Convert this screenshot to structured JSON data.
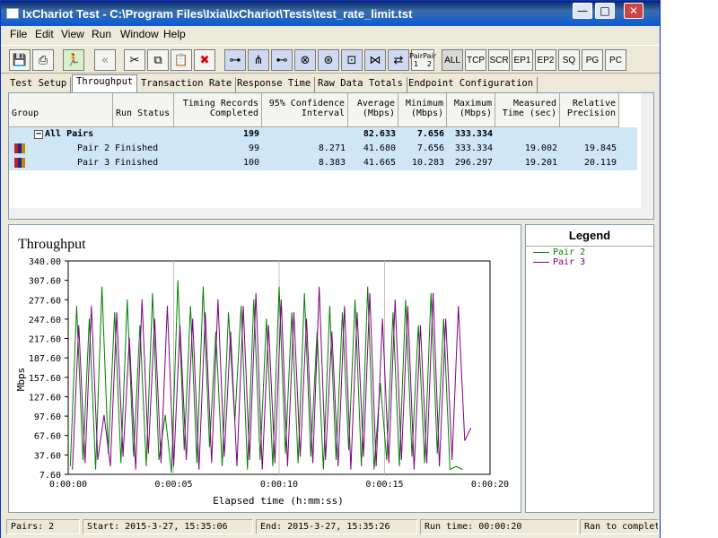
{
  "window": {
    "title": "IxChariot Test - C:\\Program Files\\Ixia\\IxChariot\\Tests\\test_rate_limit.tst"
  },
  "title_buttons": {
    "minimize": "—",
    "maximize": "□",
    "close": "✕"
  },
  "menu": [
    "File",
    "Edit",
    "View",
    "Run",
    "Window",
    "Help"
  ],
  "toolbar": {
    "icons": [
      "save-icon",
      "print-icon",
      "run-icon",
      "back-arrows-icon",
      "cut-icon",
      "copy-icon",
      "paste-icon",
      "delete-icon",
      "pair-icon",
      "multicast-icon",
      "mpair-icon",
      "group-icon",
      "group2-icon",
      "pair-edit-icon",
      "pair-group-icon",
      "pair-swap-icon"
    ],
    "pair_label_1": "Pair 1",
    "pair_label_2": "Pair 2",
    "filters": [
      "ALL",
      "TCP",
      "SCR",
      "EP1",
      "EP2",
      "SQ",
      "PG",
      "PC"
    ]
  },
  "tabs": [
    "Test Setup",
    "Throughput",
    "Transaction Rate",
    "Response Time",
    "Raw Data Totals",
    "Endpoint Configuration"
  ],
  "grid": {
    "headers": [
      {
        "l1": "",
        "l2": "Group"
      },
      {
        "l1": "",
        "l2": "Run Status"
      },
      {
        "l1": "Timing Records",
        "l2": "Completed"
      },
      {
        "l1": "95% Confidence",
        "l2": "Interval"
      },
      {
        "l1": "Average",
        "l2": "(Mbps)"
      },
      {
        "l1": "Minimum",
        "l2": "(Mbps)"
      },
      {
        "l1": "Maximum",
        "l2": "(Mbps)"
      },
      {
        "l1": "Measured",
        "l2": "Time (sec)"
      },
      {
        "l1": "Relative",
        "l2": "Precision"
      }
    ],
    "all_pairs": {
      "expander": "−",
      "name": "All Pairs",
      "records": "199",
      "average": "82.633",
      "minimum": "7.656",
      "maximum": "333.334"
    },
    "rows": [
      {
        "name": "Pair 2",
        "status": "Finished",
        "records": "99",
        "ci": "8.271",
        "average": "41.680",
        "minimum": "7.656",
        "maximum": "333.334",
        "time": "19.002",
        "precision": "19.845"
      },
      {
        "name": "Pair 3",
        "status": "Finished",
        "records": "100",
        "ci": "8.383",
        "average": "41.665",
        "minimum": "10.283",
        "maximum": "296.297",
        "time": "19.201",
        "precision": "20.119"
      }
    ]
  },
  "legend": {
    "title": "Legend",
    "items": [
      {
        "label": "Pair 2",
        "color": "#008000"
      },
      {
        "label": "Pair 3",
        "color": "#800080"
      }
    ]
  },
  "chart_data": {
    "type": "line",
    "title": "Throughput",
    "xlabel": "Elapsed time (h:mm:ss)",
    "ylabel": "Mbps",
    "ylim": [
      7.6,
      340.0
    ],
    "xlim": [
      0,
      20
    ],
    "yticks": [
      "340.00",
      "307.60",
      "277.60",
      "247.60",
      "217.60",
      "187.60",
      "157.60",
      "127.60",
      "97.60",
      "67.60",
      "37.60",
      "7.60"
    ],
    "xticks": [
      "0:00:00",
      "0:00:05",
      "0:00:10",
      "0:00:15",
      "0:00:20"
    ],
    "grid": true,
    "series": [
      {
        "name": "Pair 2",
        "color": "#008000",
        "x": [
          0.1,
          0.4,
          0.7,
          1.0,
          1.3,
          1.6,
          1.9,
          2.2,
          2.5,
          2.8,
          3.1,
          3.4,
          3.7,
          4.0,
          4.3,
          4.6,
          4.9,
          5.2,
          5.5,
          5.8,
          6.1,
          6.4,
          6.7,
          7.0,
          7.3,
          7.6,
          7.9,
          8.2,
          8.5,
          8.8,
          9.1,
          9.4,
          9.7,
          10.0,
          10.3,
          10.6,
          10.9,
          11.2,
          11.5,
          11.8,
          12.1,
          12.4,
          12.7,
          13.0,
          13.3,
          13.6,
          13.9,
          14.2,
          14.5,
          14.8,
          15.1,
          15.4,
          15.7,
          16.0,
          16.3,
          16.6,
          16.9,
          17.2,
          17.5,
          17.8,
          18.1,
          18.4,
          18.7
        ],
        "y": [
          20,
          270,
          30,
          250,
          15,
          300,
          40,
          260,
          25,
          280,
          35,
          240,
          20,
          290,
          30,
          100,
          10,
          310,
          45,
          270,
          25,
          300,
          50,
          230,
          20,
          260,
          90,
          270,
          15,
          280,
          30,
          250,
          20,
          300,
          40,
          260,
          25,
          290,
          35,
          230,
          15,
          270,
          30,
          260,
          45,
          280,
          20,
          300,
          15,
          150,
          30,
          260,
          20,
          280,
          35,
          240,
          25,
          290,
          40,
          250,
          15,
          20,
          15
        ]
      },
      {
        "name": "Pair 3",
        "color": "#800080",
        "x": [
          0.2,
          0.5,
          0.8,
          1.1,
          1.4,
          1.7,
          2.0,
          2.3,
          2.6,
          2.9,
          3.2,
          3.5,
          3.8,
          4.1,
          4.4,
          4.7,
          5.0,
          5.3,
          5.6,
          5.9,
          6.2,
          6.5,
          6.8,
          7.1,
          7.4,
          7.7,
          8.0,
          8.3,
          8.6,
          8.9,
          9.2,
          9.5,
          9.8,
          10.1,
          10.4,
          10.7,
          11.0,
          11.3,
          11.6,
          11.9,
          12.2,
          12.5,
          12.8,
          13.1,
          13.4,
          13.7,
          14.0,
          14.3,
          14.6,
          14.9,
          15.2,
          15.5,
          15.8,
          16.1,
          16.4,
          16.7,
          17.0,
          17.3,
          17.6,
          17.9,
          18.2,
          18.5,
          18.8,
          19.1
        ],
        "y": [
          15,
          240,
          25,
          270,
          30,
          100,
          20,
          260,
          35,
          220,
          15,
          280,
          40,
          250,
          25,
          270,
          20,
          240,
          30,
          250,
          15,
          260,
          25,
          280,
          35,
          230,
          20,
          270,
          30,
          290,
          15,
          240,
          25,
          280,
          20,
          260,
          35,
          250,
          25,
          300,
          30,
          230,
          20,
          270,
          15,
          260,
          35,
          290,
          20,
          250,
          25,
          280,
          30,
          270,
          15,
          240,
          25,
          290,
          20,
          250,
          30,
          270,
          60,
          80
        ]
      }
    ]
  },
  "status": {
    "pairs": "Pairs: 2",
    "start": "Start: 2015-3-27, 15:35:06",
    "end": "End: 2015-3-27, 15:35:26",
    "runtime": "Run time: 00:00:20",
    "state": "Ran to completion"
  }
}
